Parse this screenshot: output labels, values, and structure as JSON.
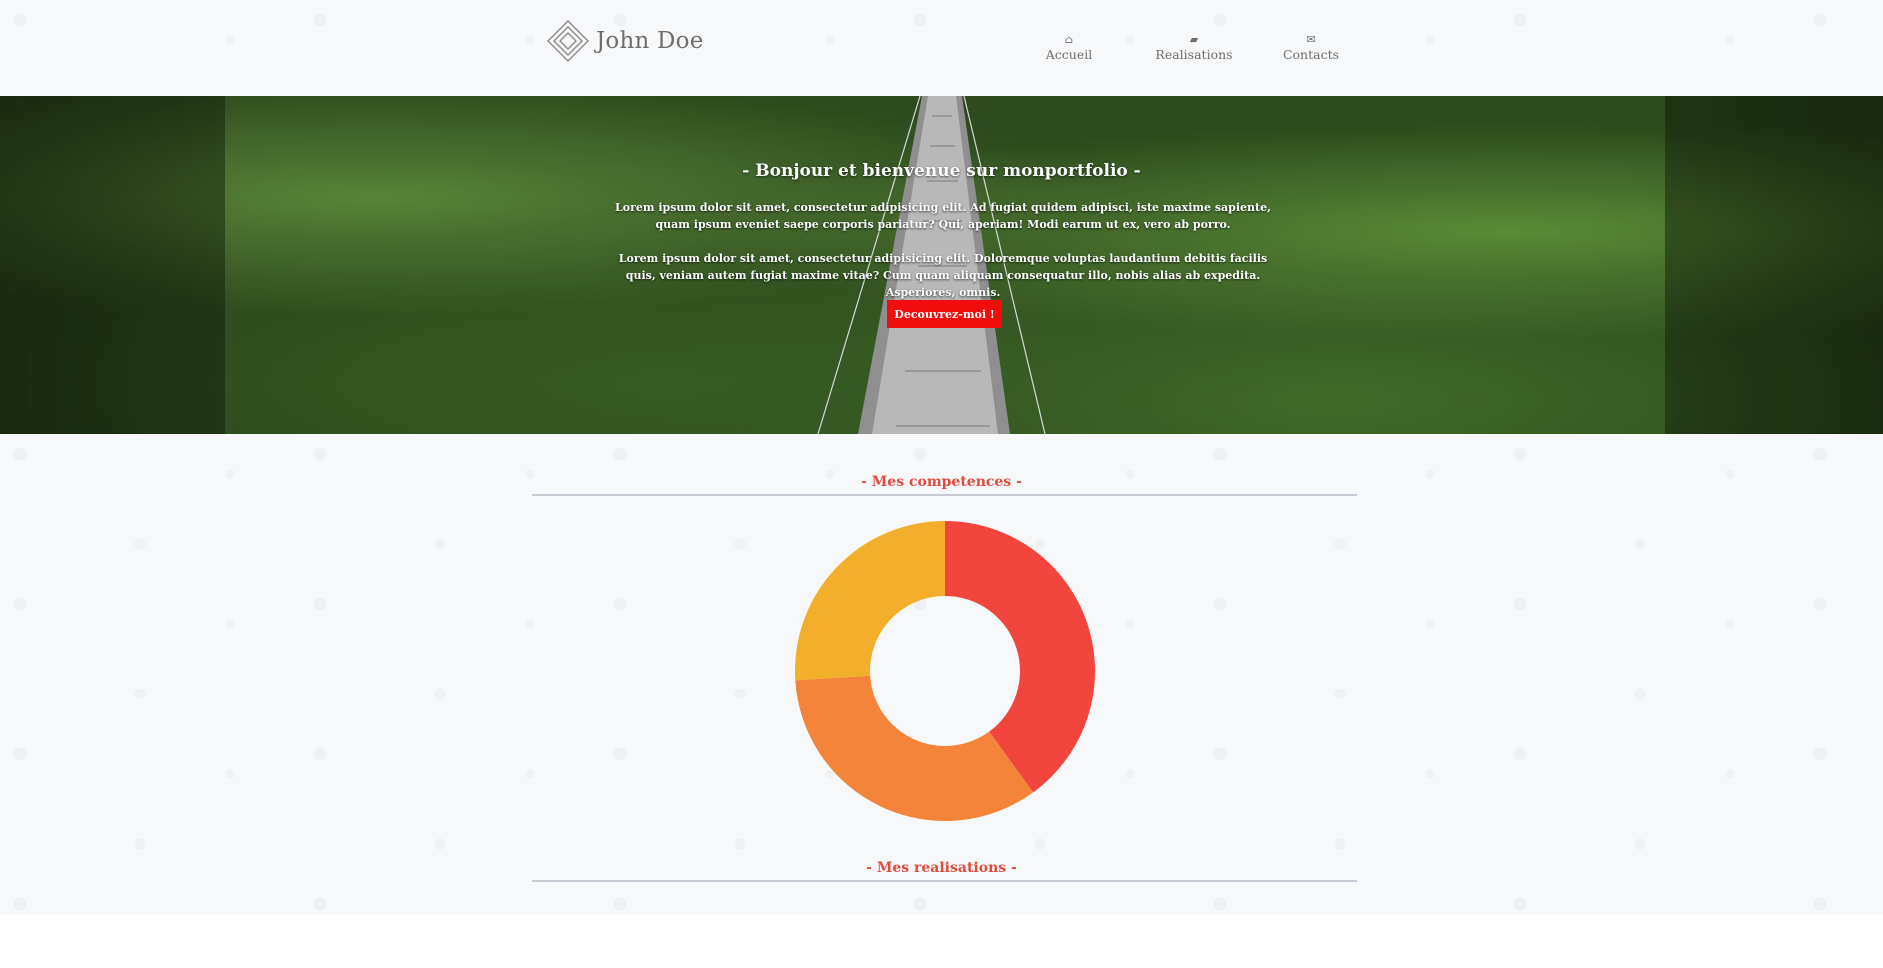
{
  "header": {
    "brand_name": "John Doe",
    "nav": [
      {
        "label": "Accueil",
        "icon": "home-icon",
        "glyph": "⌂"
      },
      {
        "label": "Realisations",
        "icon": "folder-open-icon",
        "glyph": "▰"
      },
      {
        "label": "Contacts",
        "icon": "envelope-icon",
        "glyph": "✉"
      }
    ]
  },
  "hero": {
    "title": "- Bonjour et bienvenue sur monportfolio -",
    "paragraph_1": "Lorem ipsum dolor sit amet, consectetur adipisicing elit. Ad fugiat quidem adipisci, iste maxime sapiente, quam ipsum eveniet saepe corporis pariatur? Qui, aperiam! Modi earum ut ex, vero ab porro.",
    "paragraph_2": "Lorem ipsum dolor sit amet, consectetur adipisicing elit. Doloremque voluptas laudantium debitis facilis quis, veniam autem fugiat maxime vitae? Cum quam aliquam consequatur illo, nobis alias ab expedita. Asperiores, omnis.",
    "cta_label": "Decouvrez-moi !"
  },
  "skills": {
    "title": "- Mes competences -"
  },
  "realisations": {
    "title": "- Mes realisations -"
  },
  "colors": {
    "accent": "#e04b3e",
    "cta": "#f20d0d",
    "text_muted": "#6e6e6e"
  },
  "chart_data": {
    "type": "pie",
    "donut": true,
    "values": [
      40,
      34,
      26
    ],
    "colors": [
      "#f2453d",
      "#f3843a",
      "#f3ae2b"
    ]
  }
}
